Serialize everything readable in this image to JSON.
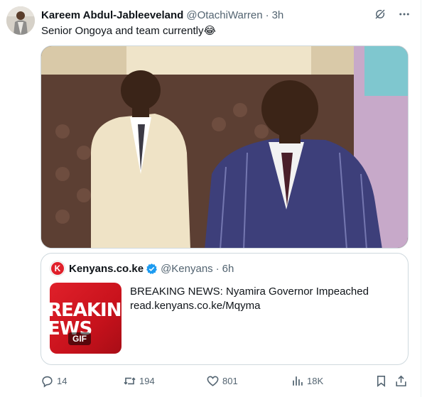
{
  "tweet": {
    "author_name": "Kareem Abdul-Jableeveland",
    "handle": "@OtachiWarren",
    "separator": "·",
    "time": "3h",
    "text": "Senior Ongoya and team currently😂"
  },
  "header_icons": [
    "grok-icon",
    "more-icon"
  ],
  "quote": {
    "name": "Kenyans.co.ke",
    "handle": "@Kenyans",
    "separator": "·",
    "time": "6h",
    "headline": "BREAKING NEWS: Nyamira Governor Impeached",
    "link": "read.kenyans.co.ke/Mqyma",
    "thumb_line1": "REAKING",
    "thumb_line2": "EWS",
    "thumb_badge": "GIF"
  },
  "actions": {
    "replies": "14",
    "retweets": "194",
    "likes": "801",
    "views": "18K"
  },
  "colors": {
    "text": "#0f1419",
    "secondary": "#536471",
    "border": "#cfd9de",
    "verified": "#1d9bf0",
    "kenyans_red": "#e0202a"
  }
}
